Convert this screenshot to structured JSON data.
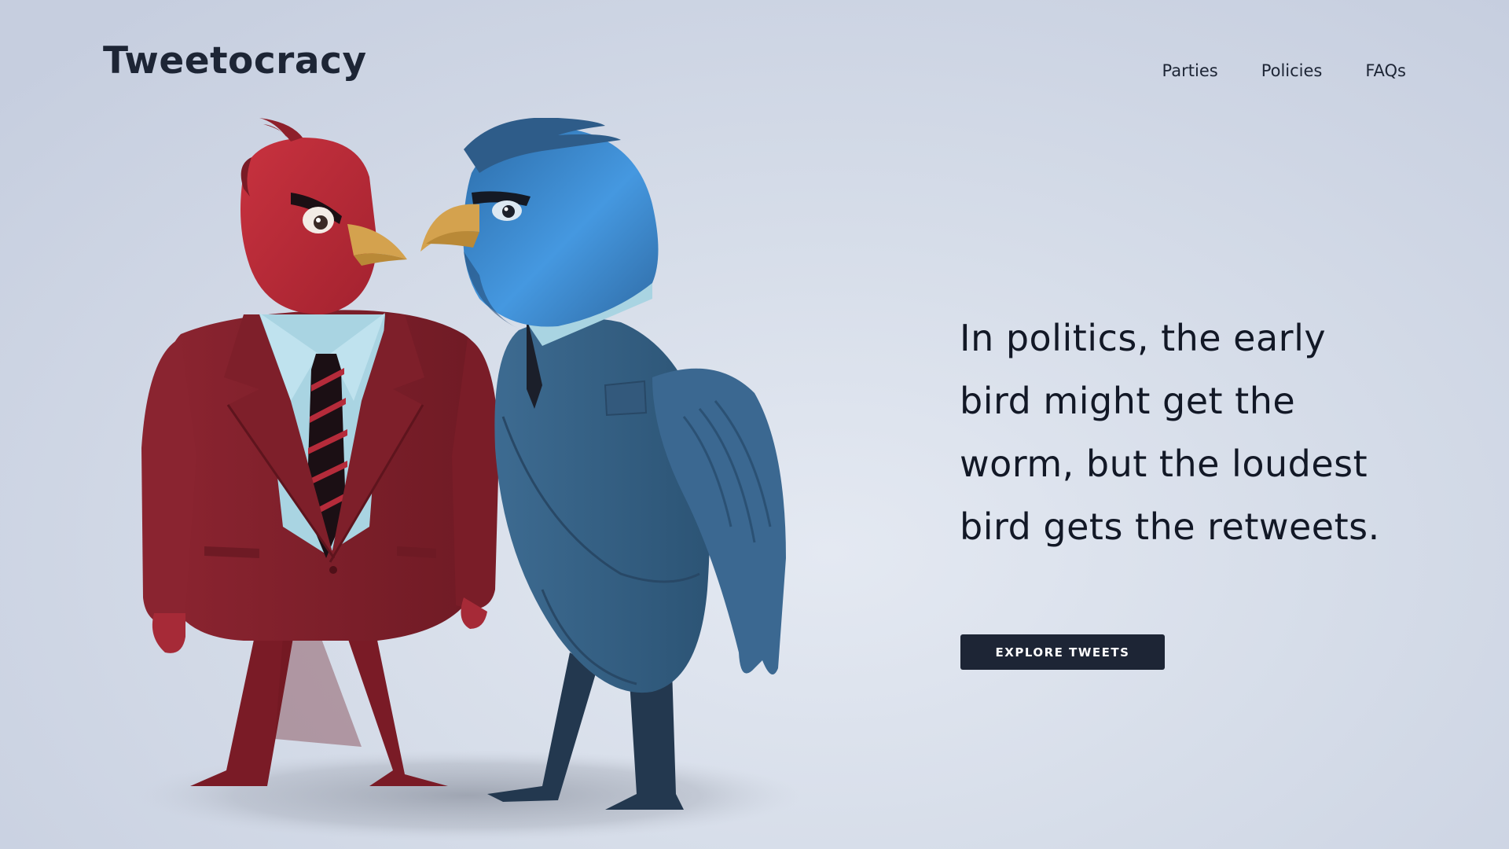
{
  "brand": {
    "name": "Tweetocracy"
  },
  "nav": {
    "items": [
      {
        "label": "Parties"
      },
      {
        "label": "Policies"
      },
      {
        "label": "FAQs"
      }
    ]
  },
  "hero": {
    "headline": "In politics, the early bird might get the worm, but the loudest bird gets the retweets.",
    "cta_label": "EXPLORE TWEETS",
    "illustration": {
      "subject": "two-birds-in-suits-icon",
      "colors": {
        "red_bird": "#b52b3a",
        "red_suit": "#7e1f2a",
        "blue_bird": "#3f8fd8",
        "blue_suit": "#345f82",
        "shirt": "#a9d4e2",
        "beak": "#d4a24e"
      }
    }
  },
  "theme": {
    "text": "#1d2535",
    "button_bg": "#1d2535",
    "button_text": "#ffffff"
  }
}
